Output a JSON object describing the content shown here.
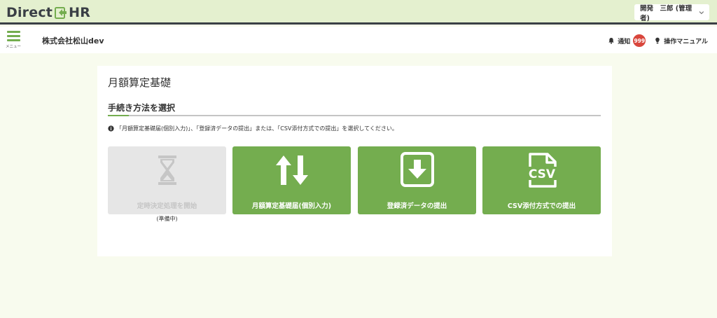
{
  "brand": {
    "logo_text_left": "Direct",
    "logo_text_right": "HR",
    "user_menu_label": "開発　三郎 (管理者)",
    "colors": {
      "accent": "#74ad4f",
      "dark": "#3a3f45",
      "badge": "#d9463c"
    }
  },
  "header": {
    "menu_label": "メニュー",
    "company": "株式会社松山dev",
    "notification_label": "通知",
    "notification_count": "999",
    "manual_label": "操作マニュアル"
  },
  "main": {
    "title": "月額算定基礎",
    "section_title": "手続き方法を選択",
    "note": "「月額算定基礎届(個別入力)」、「登録済データの提出」または、「CSV添付方式での提出」を選択してください。",
    "options": [
      {
        "label": "定時決定処理を開始",
        "icon": "hourglass-icon",
        "enabled": false,
        "sub_note": "(準備中)"
      },
      {
        "label": "月額算定基礎届(個別入力)",
        "icon": "up-down-arrows-icon",
        "enabled": true
      },
      {
        "label": "登録済データの提出",
        "icon": "download-box-icon",
        "enabled": true
      },
      {
        "label": "CSV添付方式での提出",
        "icon": "csv-file-icon",
        "enabled": true
      }
    ]
  }
}
